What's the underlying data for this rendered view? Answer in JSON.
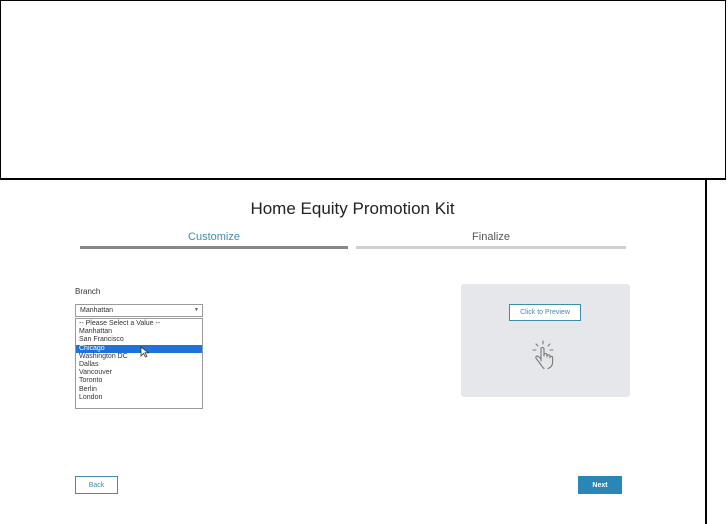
{
  "page": {
    "title": "Home Equity Promotion Kit"
  },
  "steps": [
    {
      "label": "Customize",
      "state": "active"
    },
    {
      "label": "Finalize",
      "state": "inactive"
    }
  ],
  "branch": {
    "label": "Branch",
    "selected_value": "Manhattan",
    "options": [
      "-- Please Select a Value --",
      "Manhattan",
      "San Francisco",
      "Chicago",
      "Washington DC",
      "Dallas",
      "Vancouver",
      "Toronto",
      "Berlin",
      "London"
    ],
    "highlighted_option": "Chicago"
  },
  "preview": {
    "button_label": "Click to Preview",
    "icon": "tap-hand-icon"
  },
  "nav": {
    "back_label": "Back",
    "next_label": "Next"
  },
  "colors": {
    "accent": "#3e8ea8",
    "primary_button": "#2a86b5",
    "highlight": "#1e72d9",
    "panel_bg": "#e6e7ea"
  }
}
